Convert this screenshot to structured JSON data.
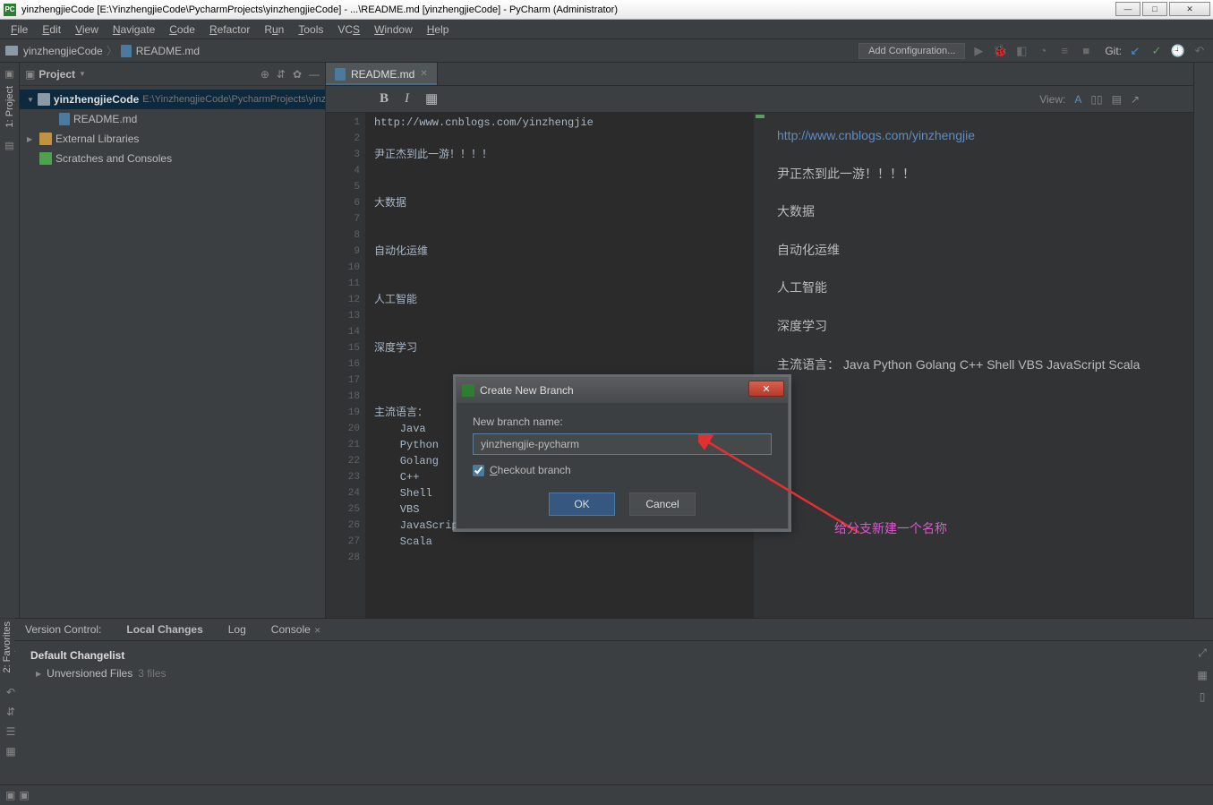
{
  "window": {
    "title": "yinzhengjieCode [E:\\YinzhengjieCode\\PycharmProjects\\yinzhengjieCode] - ...\\README.md [yinzhengjieCode] - PyCharm (Administrator)"
  },
  "menubar": [
    "File",
    "Edit",
    "View",
    "Navigate",
    "Code",
    "Refactor",
    "Run",
    "Tools",
    "VCS",
    "Window",
    "Help"
  ],
  "breadcrumb": {
    "project": "yinzhengjieCode",
    "file": "README.md"
  },
  "toolbar": {
    "add_config": "Add Configuration...",
    "git_label": "Git:"
  },
  "sidebar": {
    "tab_label": "1: Project",
    "header": "Project",
    "tree": {
      "root": "yinzhengjieCode",
      "root_path": "E:\\YinzhengjieCode\\PycharmProjects\\yinzhengjieCode",
      "file": "README.md",
      "libs": "External Libraries",
      "scratch": "Scratches and Consoles"
    }
  },
  "editor": {
    "tab": "README.md",
    "view_label": "View:",
    "lines": [
      "http://www.cnblogs.com/yinzhengjie",
      "",
      "尹正杰到此一游！！！！",
      "",
      "",
      "大数据",
      "",
      "",
      "自动化运维",
      "",
      "",
      "人工智能",
      "",
      "",
      "深度学习",
      "",
      "",
      "",
      "主流语言：",
      "    Java",
      "    Python",
      "    Golang",
      "    C++",
      "    Shell",
      "    VBS",
      "    JavaScript",
      "    Scala",
      ""
    ]
  },
  "preview": {
    "link": "http://www.cnblogs.com/yinzhengjie",
    "p1": "尹正杰到此一游！！！！",
    "p2": "大数据",
    "p3": "自动化运维",
    "p4": "人工智能",
    "p5": "深度学习",
    "p6": "主流语言：  Java Python Golang C++ Shell VBS JavaScript Scala"
  },
  "vcs": {
    "panel_title": "Version Control:",
    "tabs": [
      "Local Changes",
      "Log",
      "Console"
    ],
    "changelist": "Default Changelist",
    "unversioned": "Unversioned Files",
    "unversioned_count": "3 files"
  },
  "favorites_tab": "2: Favorites",
  "dialog": {
    "title": "Create New Branch",
    "label": "New branch name:",
    "input": "yinzhengjie-pycharm",
    "checkbox": "Checkbox",
    "checkbox_label": "Checkout branch",
    "ok": "OK",
    "cancel": "Cancel"
  },
  "annotation": "给分支新建一个名称"
}
